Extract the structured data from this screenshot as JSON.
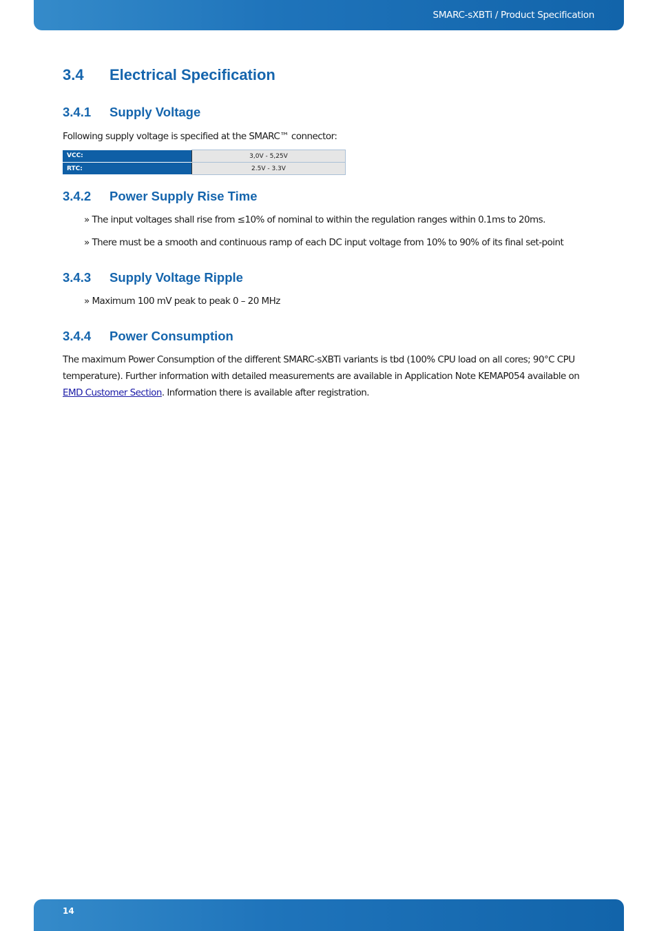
{
  "header": {
    "title": "SMARC-sXBTi / Product Specification"
  },
  "footer": {
    "page_number": "14"
  },
  "section": {
    "number": "3.4",
    "title": "Electrical Specification",
    "subsections": [
      {
        "number": "3.4.1",
        "title": "Supply Voltage",
        "intro": "Following supply voltage is specified at the SMARC™ connector:",
        "table": [
          {
            "label": "VCC:",
            "value": "3,0V - 5,25V"
          },
          {
            "label": "RTC:",
            "value": "2.5V - 3.3V"
          }
        ]
      },
      {
        "number": "3.4.2",
        "title": "Power Supply Rise Time",
        "bullets": [
          "» The input voltages shall rise from ≤10% of nominal to within the regulation ranges within 0.1ms to 20ms.",
          "» There must be a smooth and continuous ramp of each DC input voltage from 10% to 90% of its final set-point"
        ]
      },
      {
        "number": "3.4.3",
        "title": "Supply Voltage Ripple",
        "bullets": [
          "» Maximum 100 mV peak to peak 0 – 20 MHz"
        ]
      },
      {
        "number": "3.4.4",
        "title": "Power Consumption",
        "text_before_link": "The maximum Power Consumption of the different SMARC-sXBTi variants is tbd (100% CPU load on all cores; 90°C CPU temperature). Further information with detailed measurements are available in Application Note KEMAP054 available on ",
        "link_text": "EMD Customer Section",
        "text_after_link": ". Information there is available after registration."
      }
    ]
  }
}
